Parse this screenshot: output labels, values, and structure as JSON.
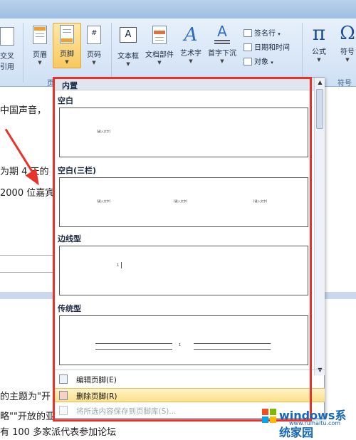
{
  "ribbon": {
    "left_partial": {
      "line1": "交叉",
      "line2": "引用"
    },
    "buttons": [
      {
        "label": "页眉"
      },
      {
        "label": "页脚"
      },
      {
        "label": "页码"
      },
      {
        "label": "文本框"
      },
      {
        "label": "文档部件"
      },
      {
        "label": "艺术字"
      },
      {
        "label": "首字下沉"
      }
    ],
    "small_cmds": {
      "signature": "签名行",
      "datetime": "日期和时间",
      "object": "对象"
    },
    "symbol_buttons": [
      {
        "label": "公式",
        "glyph": "π"
      },
      {
        "label": "符号",
        "glyph": "Ω"
      }
    ],
    "group_labels": {
      "header_footer": "页",
      "symbols": "符号"
    }
  },
  "document": {
    "lines": [
      "中国声音，",
      "为期 4 天的",
      "2000 位嘉宾",
      "的主题为\"开",
      "略\"\"开放的亚",
      "有 100 多家派代表参加论坛"
    ]
  },
  "gallery": {
    "header": "内置",
    "categories": [
      {
        "name": "空白",
        "placeholder": "[键入文字]"
      },
      {
        "name": "空白(三栏)",
        "placeholder": "[键入文字]"
      },
      {
        "name": "边线型",
        "placeholder": "1"
      },
      {
        "name": "传统型",
        "placeholder": "1"
      }
    ],
    "menu": [
      {
        "label": "编辑页脚(E)",
        "highlighted": false,
        "disabled": false
      },
      {
        "label": "删除页脚(R)",
        "highlighted": true,
        "disabled": false
      },
      {
        "label": "将所选内容保存到页脚库(S)...",
        "highlighted": false,
        "disabled": true
      }
    ]
  },
  "watermark": {
    "text": "windows系统家园",
    "sub": "www.ruihaitu.com"
  },
  "colors": {
    "accent_red": "#e8322a",
    "ribbon_blue": "#cfe0f4",
    "highlight": "#fbe08a"
  }
}
